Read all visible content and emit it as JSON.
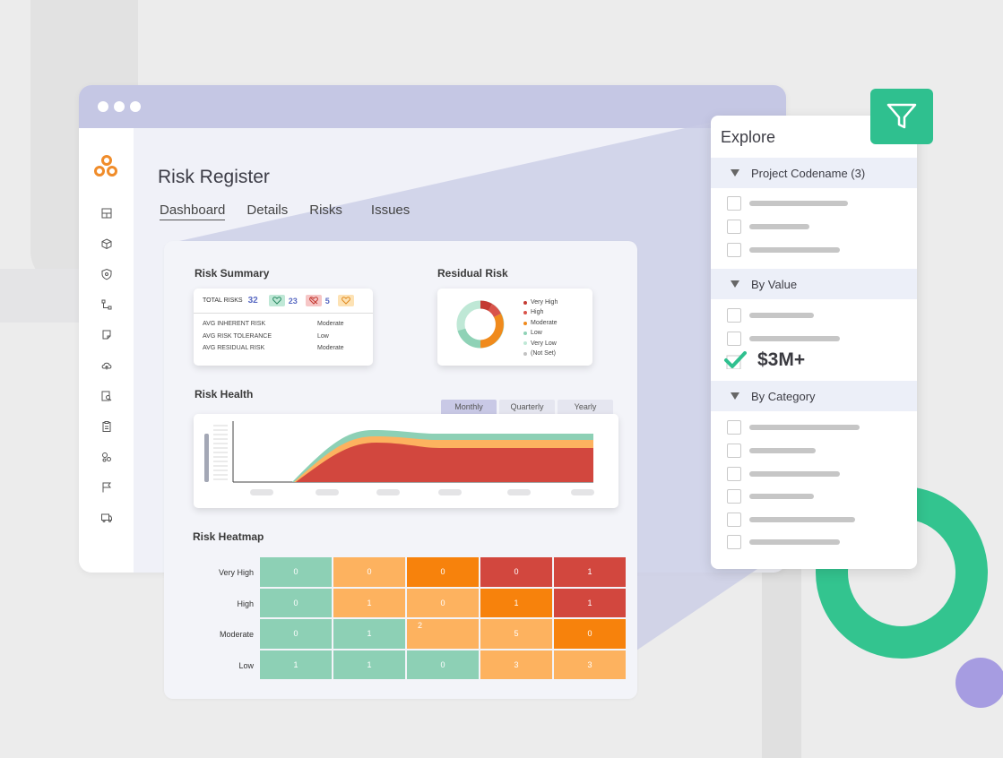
{
  "app": {
    "title": "Risk Register"
  },
  "tabs": [
    {
      "label": "Dashboard",
      "active": true
    },
    {
      "label": "Details",
      "active": false
    },
    {
      "label": "Risks",
      "active": false
    },
    {
      "label": "Issues",
      "active": false
    }
  ],
  "sidebar": {
    "icons": [
      "layout-icon",
      "box-icon",
      "shield-icon",
      "workflow-icon",
      "flag-note-icon",
      "cloud-upload-icon",
      "search-doc-icon",
      "clipboard-icon",
      "settings-group-icon",
      "flag-icon",
      "truck-icon"
    ]
  },
  "risk_summary": {
    "title": "Risk Summary",
    "total_label": "TOTAL RISKS",
    "total_value": "32",
    "badges": [
      {
        "icon": "heart-icon",
        "count": "23",
        "color": "#bfe8d6"
      },
      {
        "icon": "broken-heart-icon",
        "count": "5",
        "color": "#f6c6c6"
      },
      {
        "icon": "heart-outline-icon",
        "count": "",
        "color": "#fde2b4"
      }
    ],
    "rows": [
      {
        "label": "AVG INHERENT RISK",
        "value": "Moderate"
      },
      {
        "label": "AVG RISK TOLERANCE",
        "value": "Low"
      },
      {
        "label": "AVG RESIDUAL RISK",
        "value": "Moderate"
      }
    ]
  },
  "residual_risk": {
    "title": "Residual Risk",
    "legend": [
      {
        "label": "Very High",
        "color": "#c43b33"
      },
      {
        "label": "High",
        "color": "#d9534a"
      },
      {
        "label": "Moderate",
        "color": "#f08a1c"
      },
      {
        "label": "Low",
        "color": "#8fd2b6"
      },
      {
        "label": "Very Low",
        "color": "#bfe8d6"
      },
      {
        "label": "(Not Set)",
        "color": "#c2c2c2"
      }
    ]
  },
  "risk_health": {
    "title": "Risk Health",
    "periods": [
      {
        "label": "Monthly",
        "active": true
      },
      {
        "label": "Quarterly",
        "active": false
      },
      {
        "label": "Yearly",
        "active": false
      }
    ]
  },
  "risk_heatmap": {
    "title": "Risk Heatmap",
    "rows": [
      {
        "label": "Very High",
        "values": [
          "0",
          "0",
          "0",
          "0",
          "1"
        ]
      },
      {
        "label": "High",
        "values": [
          "0",
          "1",
          "0",
          "1",
          "1"
        ]
      },
      {
        "label": "Moderate",
        "values": [
          "0",
          "1",
          "2",
          "5",
          "0"
        ]
      },
      {
        "label": "Low",
        "values": [
          "1",
          "1",
          "0",
          "3",
          "3"
        ]
      }
    ],
    "colors": {
      "green": "#8dd0b5",
      "light_orange": "#fdb25f",
      "orange": "#f7820c",
      "red": "#d2473e"
    }
  },
  "explore": {
    "title": "Explore",
    "groups": [
      {
        "label": "Project Codename (3)"
      },
      {
        "label": "By Value",
        "checked_value": "$3M+"
      },
      {
        "label": "By Category"
      }
    ]
  },
  "colors": {
    "accent_green": "#2fc08f",
    "accent_purple": "#a69ce1",
    "logo_orange": "#f08c2a"
  }
}
